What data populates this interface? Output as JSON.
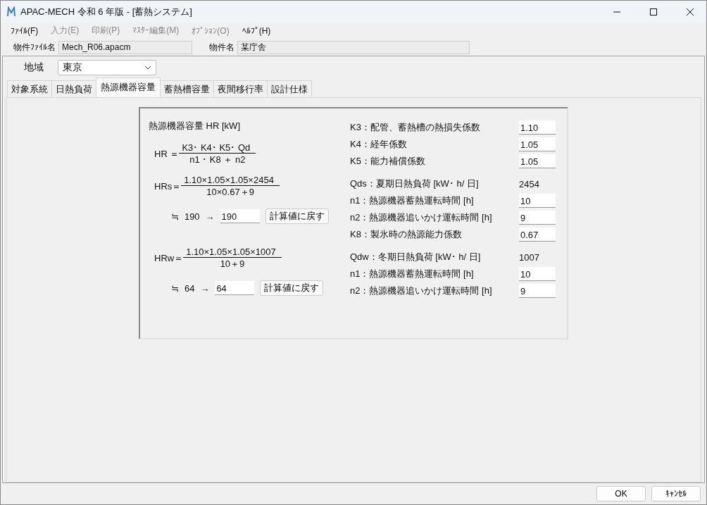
{
  "window": {
    "title": "APAC-MECH 令和 6 年版 - [蓄熱システム]"
  },
  "menu": [
    {
      "label": "ﾌｧｲﾙ(F)",
      "disabled": false
    },
    {
      "label": "入力(E)",
      "disabled": true
    },
    {
      "label": "印刷(P)",
      "disabled": true
    },
    {
      "label": "ﾏｽﾀｰ編集(M)",
      "disabled": true
    },
    {
      "label": "ｵﾌﾟｼｮﾝ(O)",
      "disabled": true
    },
    {
      "label": "ﾍﾙﾌﾟ(H)",
      "disabled": false
    }
  ],
  "file_info": [
    {
      "label": "物件ﾌｧｲﾙ名",
      "value": "Mech_R06.apacm"
    },
    {
      "label": "物件名",
      "value": "某庁舎"
    }
  ],
  "region": {
    "label": "地域",
    "value": "東京"
  },
  "tabs": [
    {
      "label": "対象系統",
      "selected": false
    },
    {
      "label": "日熱負荷",
      "selected": false
    },
    {
      "label": "熱源機器容量",
      "selected": true
    },
    {
      "label": "蓄熱槽容量",
      "selected": false
    },
    {
      "label": "夜間移行率",
      "selected": false
    },
    {
      "label": "設計仕様",
      "selected": false
    }
  ],
  "heading": "熱源機器容量 HR [kW]",
  "formulas": [
    {
      "lhs": "HR ＝",
      "numerator": "K3･ K4･ K5･ Qd",
      "denominator": "n1 ･ K8 ＋ n2"
    },
    {
      "lhs": "HRs＝",
      "numerator": "1.10×1.05×1.05×2454",
      "denominator": "10×0.67＋9",
      "approx": "≒",
      "computed": "190",
      "arrow": "→",
      "value": "190",
      "reset_button": "計算値に戻す"
    },
    {
      "lhs": "HRw＝",
      "numerator": "1.10×1.05×1.05×1007",
      "denominator": "10＋9",
      "approx": "≒",
      "computed": "64",
      "arrow": "→",
      "value": "64",
      "reset_button": "計算値に戻す"
    }
  ],
  "parameters": [
    {
      "kind": "input",
      "label": "K3：配管、蓄熱槽の熱損失係数",
      "value": "1.10"
    },
    {
      "kind": "input",
      "label": "K4：経年係数",
      "value": "1.05"
    },
    {
      "kind": "input",
      "label": "K5：能力補償係数",
      "value": "1.05"
    },
    {
      "kind": "value",
      "label": "Qds：夏期日熱負荷 [kW･ h/ 日]",
      "value": "2454"
    },
    {
      "kind": "input",
      "label": "n1：熱源機器蓄熱運転時間 [h]",
      "value": "10"
    },
    {
      "kind": "input",
      "label": "n2：熱源機器追いかけ運転時間 [h]",
      "value": "9"
    },
    {
      "kind": "input",
      "label": "K8：製氷時の熱源能力係数",
      "value": "0.67"
    },
    {
      "kind": "value",
      "label": "Qdw：冬期日熱負荷 [kW･ h/ 日]",
      "value": "1007"
    },
    {
      "kind": "input",
      "label": "n1：熱源機器蓄熱運転時間 [h]",
      "value": "10"
    },
    {
      "kind": "input",
      "label": "n2：熱源機器追いかけ運転時間 [h]",
      "value": "9"
    }
  ],
  "buttons": [
    "OK",
    "ｷｬﾝｾﾙ"
  ]
}
